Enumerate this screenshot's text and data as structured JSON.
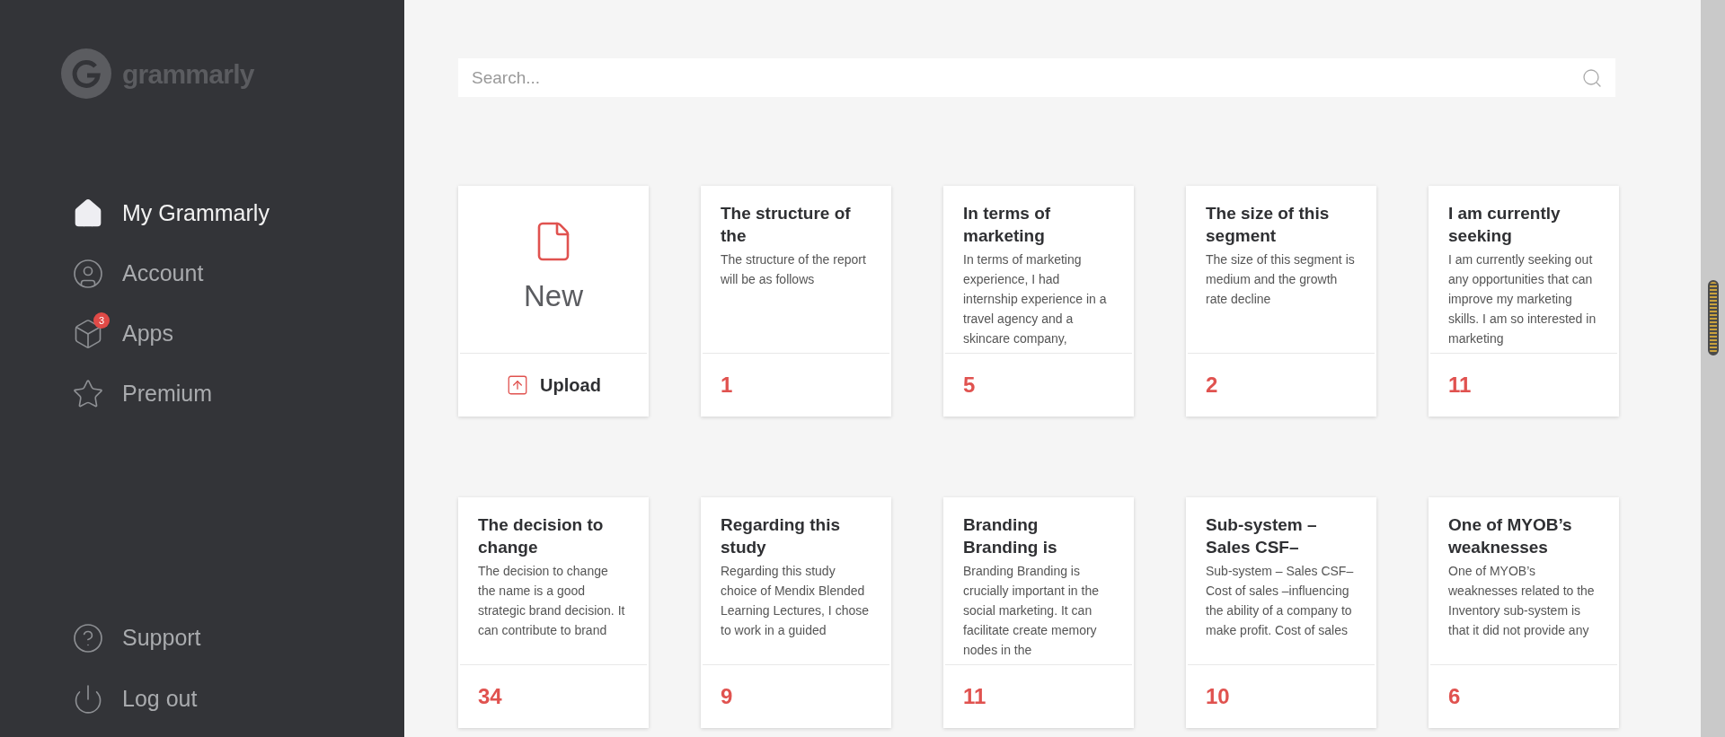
{
  "sidebar": {
    "logo": "grammarly",
    "items": [
      {
        "label": "My Grammarly",
        "kind": "home",
        "selected": true
      },
      {
        "label": "Account",
        "kind": "user",
        "selected": false
      },
      {
        "label": "Apps",
        "kind": "box",
        "selected": false,
        "badge": "3"
      },
      {
        "label": "Premium",
        "kind": "star",
        "selected": false
      }
    ],
    "footer_items": [
      {
        "label": "Support",
        "kind": "help"
      },
      {
        "label": "Log out",
        "kind": "power"
      }
    ]
  },
  "search": {
    "placeholder": "Search..."
  },
  "new_card": {
    "label": "New",
    "upload": "Upload"
  },
  "documents": [
    {
      "title": "The structure of the",
      "preview": "The structure of the report will be as follows",
      "count": "1"
    },
    {
      "title": "In terms of marketing",
      "preview": "In terms of marketing experience, I had internship experience in a travel agency and a skincare company,",
      "count": "5"
    },
    {
      "title": "The size of this segment",
      "preview": "The size of this segment is medium and the growth rate decline",
      "count": "2"
    },
    {
      "title": "I am currently seeking",
      "preview": "I am currently seeking out any opportunities that can improve my marketing skills. I am so interested in marketing",
      "count": "11"
    },
    {
      "title": "The decision to change",
      "preview": "The decision to change the name is a good strategic brand decision. It can contribute to brand",
      "count": "34"
    },
    {
      "title": "Regarding this study",
      "preview": "Regarding this study choice of Mendix Blended Learning Lectures, I chose to work in a guided",
      "count": "9"
    },
    {
      "title": "Branding Branding is",
      "preview": "Branding Branding is crucially important in the social marketing. It can facilitate create memory nodes in the",
      "count": "11"
    },
    {
      "title": "Sub-system – Sales CSF–",
      "preview": "Sub-system – Sales CSF– Cost of sales –influencing the ability of a company to make profit. Cost of sales",
      "count": "10"
    },
    {
      "title": "One of MYOB’s weaknesses",
      "preview": "One of MYOB’s weaknesses related to the Inventory sub-system is that it did not provide any",
      "count": "6"
    }
  ]
}
